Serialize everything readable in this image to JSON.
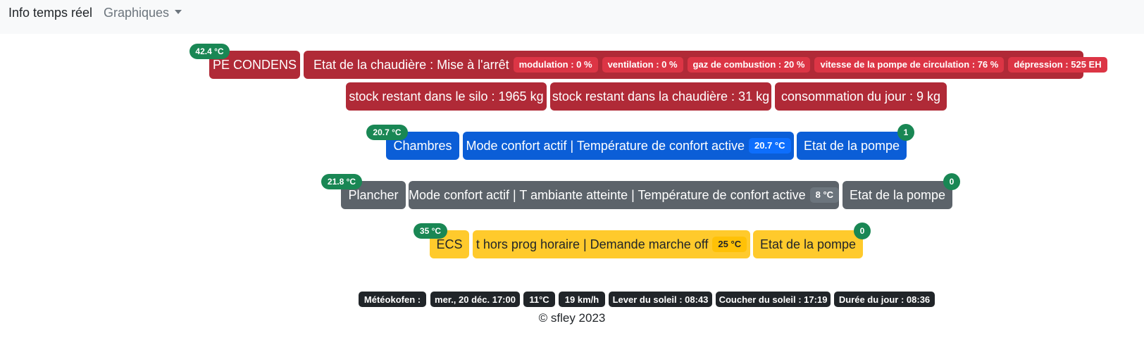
{
  "navbar": {
    "brand": "Info temps réel",
    "dropdown_label": "Graphiques"
  },
  "boiler": {
    "name": "PE CONDENS",
    "temp_badge": "42.4 °C",
    "state": "Etat de la chaudière : Mise à l'arrêt",
    "badges": [
      "modulation : 0 %",
      "ventilation : 0 %",
      "gaz de combustion : 20 %",
      "vitesse de la pompe de circulation : 76 %",
      "dépression : 525 EH"
    ],
    "stock_silo": "stock restant dans le silo : 1965 kg",
    "stock_boiler": "stock restant dans la chaudière : 31 kg",
    "consumption": "consommation du jour : 9 kg"
  },
  "circuits": [
    {
      "name": "Chambres",
      "temp_badge": "20.7 °C",
      "mode": "Mode confort actif | Température de confort active",
      "mode_badge": "20.7 °C",
      "pump": "Etat de la pompe",
      "pump_badge": "1"
    },
    {
      "name": "Plancher",
      "temp_badge": "21.8 °C",
      "mode": "Mode confort actif | T ambiante atteinte | Température de confort active",
      "mode_badge": "8 °C",
      "pump": "Etat de la pompe",
      "pump_badge": "0"
    },
    {
      "name": "ECS",
      "temp_badge": "35 °C",
      "mode": "t hors prog horaire | Demande marche off",
      "mode_badge": "25 °C",
      "pump": "Etat de la pompe",
      "pump_badge": "0"
    }
  ],
  "weather": {
    "label": "Météokofen :",
    "datetime": "mer., 20 déc. 17:00",
    "temperature": "11°C",
    "wind": "19 km/h",
    "sunrise": "Lever du soleil : 08:43",
    "sunset": "Coucher du soleil : 17:19",
    "day_length": "Durée du jour : 08:36"
  },
  "footer": "© sfley 2023",
  "colors": {
    "boiler": "#b02a37",
    "chambres": "#0b5ed7",
    "plancher": "#5c636a",
    "ecs": "#ffca2c",
    "temp_badge": "#198754"
  }
}
